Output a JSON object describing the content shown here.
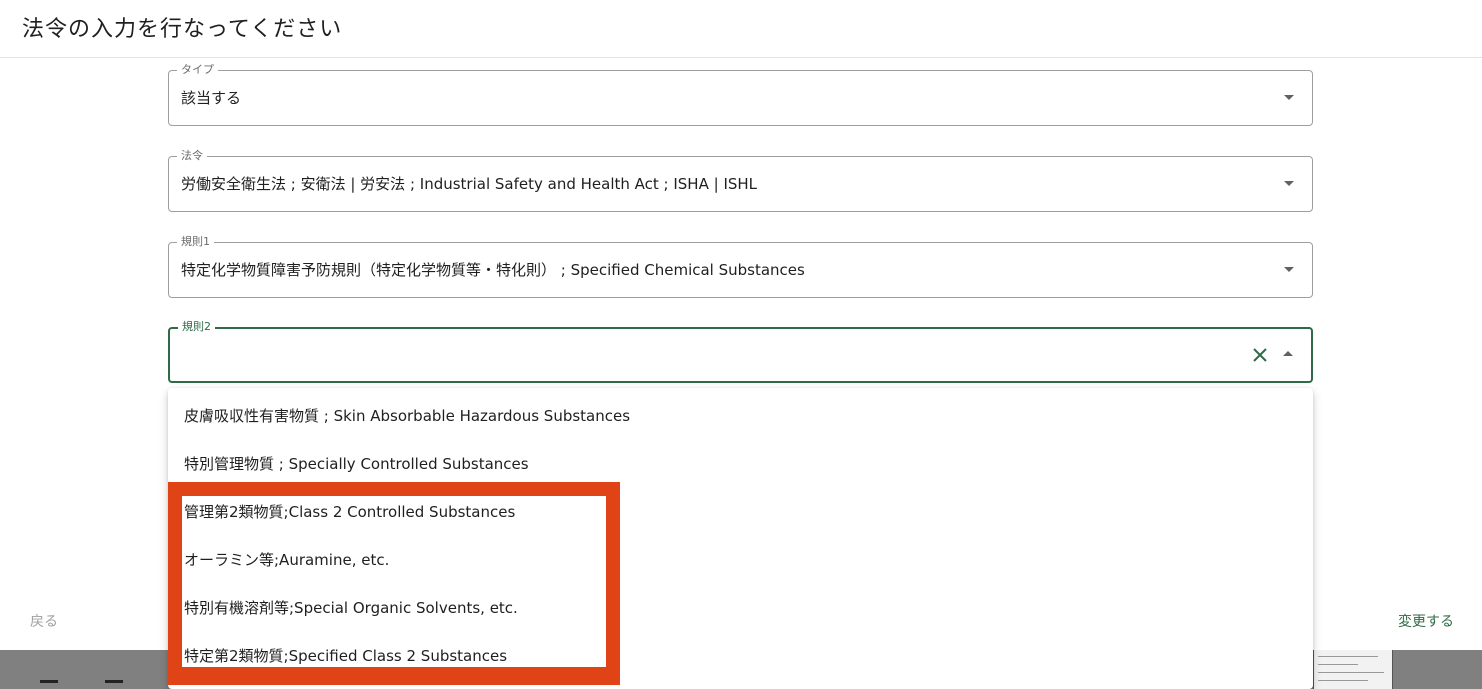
{
  "dialog": {
    "title": "法令の入力を行なってください"
  },
  "fields": {
    "type": {
      "label": "タイプ",
      "value": "該当する"
    },
    "law": {
      "label": "法令",
      "value": "労働安全衛生法 ; 安衛法 | 労安法 ; Industrial Safety and Health Act ; ISHA | ISHL"
    },
    "rule1": {
      "label": "規則1",
      "value": "特定化学物質障害予防規則（特定化学物質等・特化則） ; Specified Chemical Substances"
    },
    "rule2": {
      "label": "規則2",
      "value": ""
    }
  },
  "dropdown": {
    "options": [
      "皮膚吸収性有害物質 ; Skin Absorbable Hazardous Substances",
      "特別管理物質 ; Specially Controlled Substances",
      "管理第2類物質;Class 2 Controlled Substances",
      "オーラミン等;Auramine, etc.",
      "特別有機溶剤等;Special Organic Solvents, etc.",
      "特定第2類物質;Specified Class 2 Substances"
    ]
  },
  "footer": {
    "back_label": "戻る",
    "submit_label": "変更する"
  },
  "colors": {
    "accent": "#2e6b46",
    "highlight": "#e04416"
  }
}
